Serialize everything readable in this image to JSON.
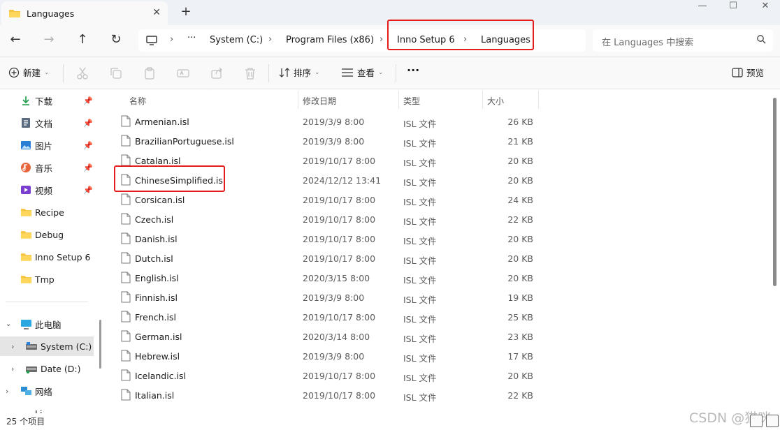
{
  "window": {
    "tab_title": "Languages",
    "new_tab": "+",
    "minimize": "—",
    "maximize": "☐",
    "close": "✕"
  },
  "nav": {
    "back": "←",
    "forward": "→",
    "up": "↑",
    "refresh": "↻"
  },
  "breadcrumb": {
    "more": "···",
    "items": [
      "System (C:)",
      "Program Files (x86)",
      "Inno Setup 6",
      "Languages"
    ]
  },
  "search": {
    "placeholder": "在 Languages 中搜索"
  },
  "toolbar": {
    "new_label": "新建",
    "sort_label": "排序",
    "view_label": "查看",
    "more_label": "···",
    "preview_label": "预览"
  },
  "sidebar": {
    "quick_access": [
      {
        "label": "下载",
        "icon": "download-icon"
      },
      {
        "label": "文档",
        "icon": "document-icon"
      },
      {
        "label": "图片",
        "icon": "pictures-icon"
      },
      {
        "label": "音乐",
        "icon": "music-icon"
      },
      {
        "label": "视频",
        "icon": "video-icon"
      },
      {
        "label": "Recipe",
        "icon": "folder-icon"
      },
      {
        "label": "Debug",
        "icon": "folder-icon"
      },
      {
        "label": "Inno Setup 6",
        "icon": "folder-icon"
      },
      {
        "label": "Tmp",
        "icon": "folder-icon"
      }
    ],
    "this_pc": "此电脑",
    "drives": [
      "System (C:)",
      "Date (D:)"
    ],
    "network": "网络",
    "next_partial": "Li"
  },
  "columns": {
    "name": "名称",
    "date": "修改日期",
    "type": "类型",
    "size": "大小"
  },
  "files": [
    {
      "name": "Armenian.isl",
      "date": "2019/3/9 8:00",
      "type": "ISL 文件",
      "size": "26 KB"
    },
    {
      "name": "BrazilianPortuguese.isl",
      "date": "2019/3/9 8:00",
      "type": "ISL 文件",
      "size": "21 KB"
    },
    {
      "name": "Catalan.isl",
      "date": "2019/10/17 8:00",
      "type": "ISL 文件",
      "size": "20 KB"
    },
    {
      "name": "ChineseSimplified.isl",
      "date": "2024/12/12 13:41",
      "type": "ISL 文件",
      "size": "20 KB"
    },
    {
      "name": "Corsican.isl",
      "date": "2019/10/17 8:00",
      "type": "ISL 文件",
      "size": "24 KB"
    },
    {
      "name": "Czech.isl",
      "date": "2019/10/17 8:00",
      "type": "ISL 文件",
      "size": "22 KB"
    },
    {
      "name": "Danish.isl",
      "date": "2019/10/17 8:00",
      "type": "ISL 文件",
      "size": "20 KB"
    },
    {
      "name": "Dutch.isl",
      "date": "2019/10/17 8:00",
      "type": "ISL 文件",
      "size": "20 KB"
    },
    {
      "name": "English.isl",
      "date": "2020/3/15 8:00",
      "type": "ISL 文件",
      "size": "20 KB"
    },
    {
      "name": "Finnish.isl",
      "date": "2019/3/9 8:00",
      "type": "ISL 文件",
      "size": "19 KB"
    },
    {
      "name": "French.isl",
      "date": "2019/10/17 8:00",
      "type": "ISL 文件",
      "size": "25 KB"
    },
    {
      "name": "German.isl",
      "date": "2020/3/14 8:00",
      "type": "ISL 文件",
      "size": "23 KB"
    },
    {
      "name": "Hebrew.isl",
      "date": "2019/3/9 8:00",
      "type": "ISL 文件",
      "size": "17 KB"
    },
    {
      "name": "Icelandic.isl",
      "date": "2019/10/17 8:00",
      "type": "ISL 文件",
      "size": "20 KB"
    },
    {
      "name": "Italian.isl",
      "date": "2019/10/17 8:00",
      "type": "ISL 文件",
      "size": "22 KB"
    }
  ],
  "status": {
    "count": "25 个项目"
  },
  "watermark": "CSDN @猫咪",
  "colors": {
    "highlight": "#e51c1c",
    "folder": "#f5c33b",
    "accent": "#0067c0"
  }
}
